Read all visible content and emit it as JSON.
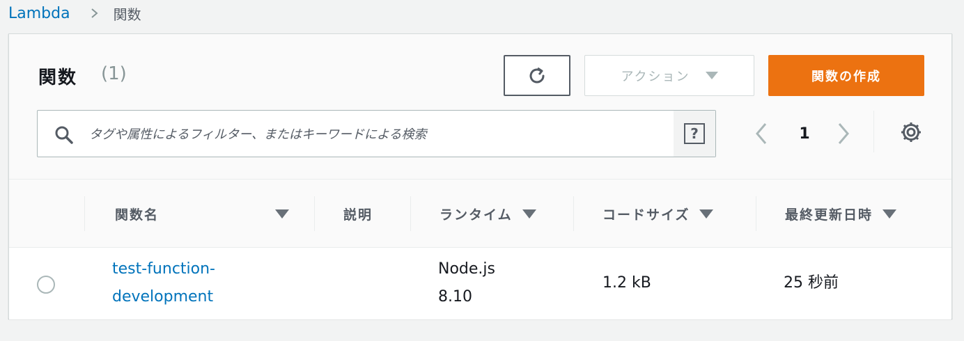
{
  "breadcrumb": {
    "root": "Lambda",
    "current": "関数"
  },
  "panel": {
    "title": "関数",
    "count": "(1)",
    "refresh_icon": "refresh-icon",
    "actions_label": "アクション",
    "create_label": "関数の作成",
    "search": {
      "placeholder": "タグや属性によるフィルター、またはキーワードによる検索",
      "value": ""
    },
    "pagination": {
      "page": "1"
    }
  },
  "table": {
    "headers": {
      "name": "関数名",
      "description": "説明",
      "runtime": "ランタイム",
      "code_size": "コードサイズ",
      "last_modified": "最終更新日時"
    },
    "rows": [
      {
        "name_line1": "test-function-",
        "name_line2": "development",
        "description": "",
        "runtime_line1": "Node.js",
        "runtime_line2": "8.10",
        "code_size": "1.2 kB",
        "last_modified": "25 秒前"
      }
    ]
  },
  "colors": {
    "link": "#0073bb",
    "primary_button": "#ec7211",
    "disabled_text": "#aab7b8",
    "background": "#f2f3f3"
  }
}
